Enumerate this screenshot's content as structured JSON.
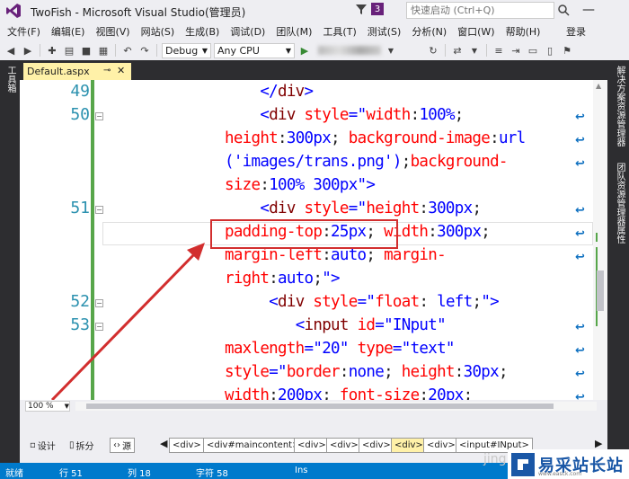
{
  "window": {
    "title": "TwoFish - Microsoft Visual Studio(管理员)",
    "notification_count": "3",
    "quick_launch_placeholder": "快速启动 (Ctrl+Q)",
    "minimize_glyph": "—"
  },
  "menu": {
    "items": [
      "文件(F)",
      "编辑(E)",
      "视图(V)",
      "网站(S)",
      "生成(B)",
      "调试(D)",
      "团队(M)",
      "工具(T)",
      "测试(S)",
      "分析(N)",
      "窗口(W)",
      "帮助(H)"
    ],
    "login": "登录"
  },
  "toolbar": {
    "config": "Debug",
    "platform": "Any CPU"
  },
  "side_panels": {
    "left": "工具箱",
    "right": [
      "解决方案资源管理器",
      "团队资源管理器",
      "属性"
    ]
  },
  "tab": {
    "label": "Default.aspx"
  },
  "editor": {
    "line_numbers": [
      {
        "n": "49",
        "row": 0
      },
      {
        "n": "50",
        "row": 1
      },
      {
        "n": "51",
        "row": 5
      },
      {
        "n": "52",
        "row": 9
      },
      {
        "n": "53",
        "row": 10
      }
    ]
  },
  "zoom": "100 %",
  "view": {
    "design": "设计",
    "split": "拆分",
    "source": "源"
  },
  "breadcrumbs": [
    "<div>",
    "<div#maincontent>",
    "<div>",
    "<div>",
    "<div>",
    "<div>",
    "<div>",
    "<input#INput>"
  ],
  "status": {
    "ready": "就绪",
    "line": "行 51",
    "col": "列 18",
    "char": "字符 58",
    "mode": "Ins"
  },
  "watermark": {
    "text": "易采站长站",
    "sub": "www.easck.com",
    "faint": "jing"
  },
  "colors": {
    "accent": "#007acc",
    "line_number": "#2b91af",
    "tag": "#800000",
    "attribute": "#ff0000",
    "value": "#0000ff",
    "annotation": "#d22e2e"
  }
}
